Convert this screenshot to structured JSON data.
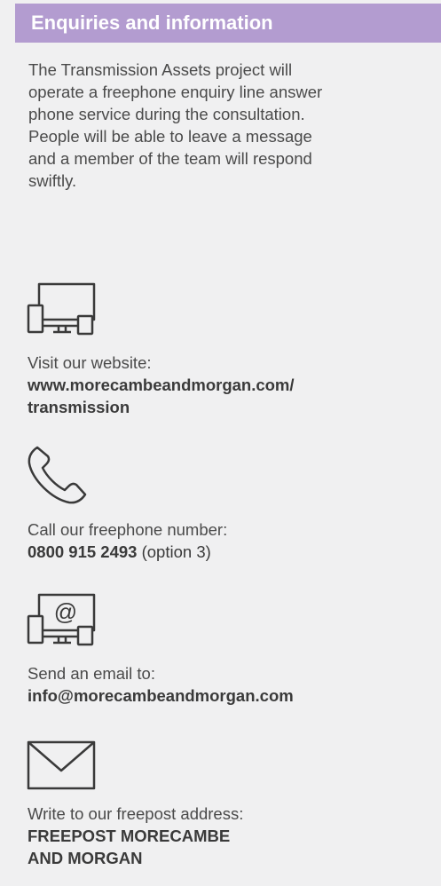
{
  "header": {
    "title": "Enquiries and information"
  },
  "intro": {
    "lines": [
      "The Transmission Assets project will",
      "operate a freephone enquiry line answer",
      "phone service during the consultation.",
      "People will be able to leave a message",
      "and a member of the team will respond",
      "swiftly."
    ]
  },
  "contacts": [
    {
      "icon": "devices-icon",
      "label": "Visit our website:",
      "value_lines": [
        "www.morecambeandmorgan.com/",
        "transmission"
      ]
    },
    {
      "icon": "phone-icon",
      "label": "Call our freephone number:",
      "value": "0800 915 2493",
      "note": " (option 3)"
    },
    {
      "icon": "email-devices-icon",
      "label": "Send an email to:",
      "value": "info@morecambeandmorgan.com"
    },
    {
      "icon": "envelope-icon",
      "label": "Write to our freepost address:",
      "value_lines": [
        "FREEPOST MORECAMBE",
        "AND MORGAN"
      ]
    }
  ],
  "colors": {
    "header_bg": "#b39cd0",
    "panel_bg": "#f0f0f1",
    "text": "#4a4a4a"
  }
}
